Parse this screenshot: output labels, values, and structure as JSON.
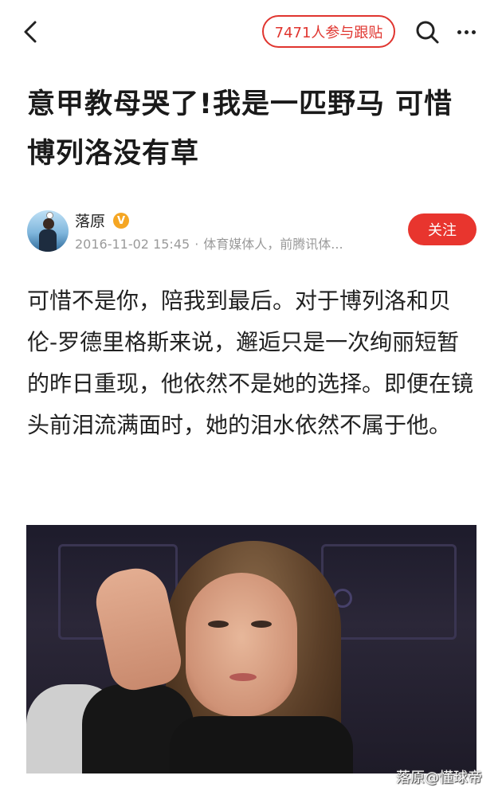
{
  "topbar": {
    "follow_post_label": "7471人参与跟贴"
  },
  "article": {
    "title": "意甲教母哭了!我是一匹野马 可惜博列洛没有草",
    "author": {
      "name": "落原",
      "verified_mark": "V",
      "date": "2016-11-02 15:45",
      "separator": "·",
      "bio": "体育媒体人，前腾讯体...",
      "follow_label": "关注"
    },
    "paragraph": "可惜不是你，陪我到最后。对于博列洛和贝伦-罗德里格斯来说，邂逅只是一次绚丽短暂的昨日重现，他依然不是她的选择。即便在镜头前泪流满面时，她的泪水依然不属于他。",
    "image_watermark": "落原@懂球帝"
  },
  "colors": {
    "accent": "#e8352e",
    "text": "#222222",
    "meta": "#9a9a9a",
    "verified": "#f5a623"
  },
  "icons": {
    "back": "back-arrow-icon",
    "search": "search-icon",
    "more": "more-dots-icon",
    "verified": "verified-badge-icon"
  }
}
